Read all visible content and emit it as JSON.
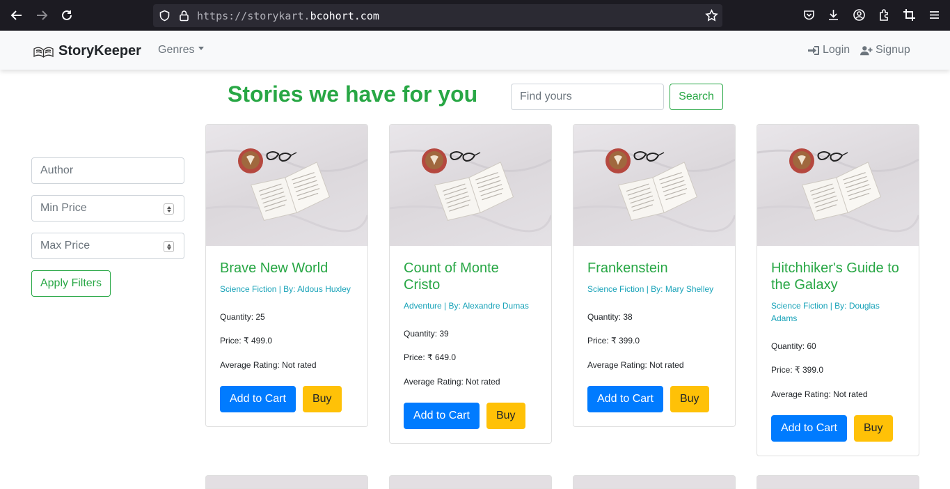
{
  "browser": {
    "url_prefix": "https://storykart.",
    "url_domain": "bcohort.com",
    "icons": [
      "back-arrow-icon",
      "forward-arrow-icon",
      "reload-icon",
      "shield-icon",
      "lock-icon",
      "star-icon",
      "pocket-icon",
      "download-icon",
      "account-icon",
      "extensions-icon",
      "crop-icon",
      "menu-icon"
    ]
  },
  "navbar": {
    "brand": "StoryKeeper",
    "genres": "Genres",
    "login": "Login",
    "signup": "Signup"
  },
  "header": {
    "title": "Stories we have for you",
    "search_placeholder": "Find yours",
    "search_button": "Search"
  },
  "filters": {
    "author_placeholder": "Author",
    "min_price_placeholder": "Min Price",
    "max_price_placeholder": "Max Price",
    "apply_button": "Apply Filters"
  },
  "books": [
    {
      "title": "Brave New World",
      "subtitle": "Science Fiction | By: Aldous Huxley",
      "quantity": "Quantity: 25",
      "price": "Price: ₹ 499.0",
      "rating": "Average Rating: Not rated",
      "cart": "Add to Cart",
      "buy": "Buy"
    },
    {
      "title": "Count of Monte Cristo",
      "subtitle": "Adventure | By: Alexandre Dumas",
      "quantity": "Quantity: 39",
      "price": "Price: ₹ 649.0",
      "rating": "Average Rating: Not rated",
      "cart": "Add to Cart",
      "buy": "Buy"
    },
    {
      "title": "Frankenstein",
      "subtitle": "Science Fiction | By: Mary Shelley",
      "quantity": "Quantity: 38",
      "price": "Price: ₹ 399.0",
      "rating": "Average Rating: Not rated",
      "cart": "Add to Cart",
      "buy": "Buy"
    },
    {
      "title": "Hitchhiker's Guide to the Galaxy",
      "subtitle": "Science Fiction | By: Douglas Adams",
      "quantity": "Quantity: 60",
      "price": "Price: ₹ 399.0",
      "rating": "Average Rating: Not rated",
      "cart": "Add to Cart",
      "buy": "Buy"
    }
  ],
  "colors": {
    "accent_green": "#28a745",
    "info_teal": "#17a2b8",
    "primary_blue": "#007bff",
    "warning_yellow": "#ffc107"
  }
}
